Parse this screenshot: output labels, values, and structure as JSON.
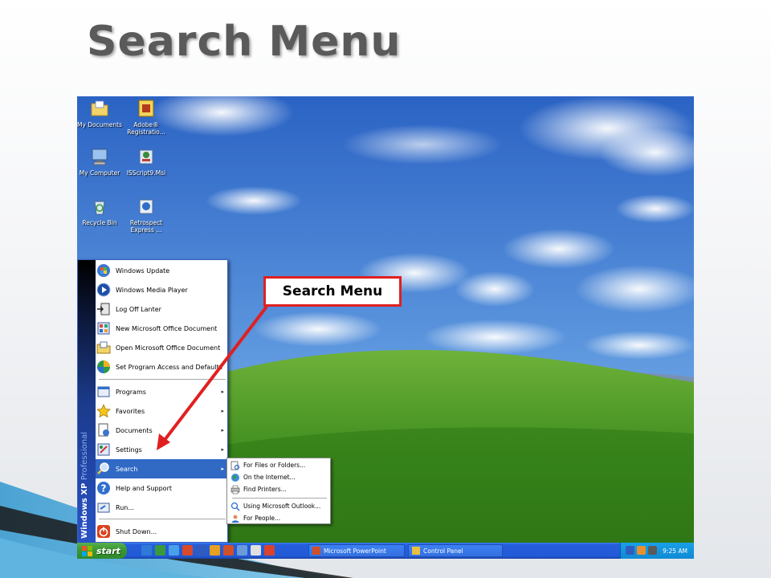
{
  "slide": {
    "title": "Search Menu"
  },
  "callout": {
    "label": "Search Menu",
    "color": "#e02020"
  },
  "desktop_icons": [
    {
      "label_line1": "My Documents",
      "label_line2": "",
      "icon": "folder-icon"
    },
    {
      "label_line1": "Adobe®",
      "label_line2": "Registratio...",
      "icon": "adobe-icon"
    },
    {
      "label_line1": "My Computer",
      "label_line2": "",
      "icon": "computer-icon"
    },
    {
      "label_line1": "ISScript9.Msi",
      "label_line2": "",
      "icon": "installer-icon"
    },
    {
      "label_line1": "Recycle Bin",
      "label_line2": "",
      "icon": "recycle-bin-icon"
    },
    {
      "label_line1": "Retrospect",
      "label_line2": "Express ...",
      "icon": "retrospect-icon"
    }
  ],
  "start_menu": {
    "banner": {
      "os": "Windows XP",
      "edition": "Professional"
    },
    "top_items": [
      {
        "label": "Windows Update",
        "icon": "windows-update-icon"
      },
      {
        "label": "Windows Media Player",
        "icon": "media-player-icon"
      },
      {
        "label": "Log Off Lanter",
        "icon": "log-off-icon"
      },
      {
        "label": "New Microsoft Office Document",
        "icon": "new-office-doc-icon"
      },
      {
        "label": "Open Microsoft Office Document",
        "icon": "open-office-doc-icon"
      },
      {
        "label": "Set Program Access and Defaults",
        "icon": "program-defaults-icon"
      }
    ],
    "main_items": [
      {
        "label": "Programs",
        "icon": "programs-icon",
        "arrow": "▸"
      },
      {
        "label": "Favorites",
        "icon": "favorites-icon",
        "arrow": "▸"
      },
      {
        "label": "Documents",
        "icon": "documents-icon",
        "arrow": "▸"
      },
      {
        "label": "Settings",
        "icon": "settings-icon",
        "arrow": "▸"
      },
      {
        "label": "Search",
        "icon": "search-icon",
        "arrow": "▸"
      },
      {
        "label": "Help and Support",
        "icon": "help-icon",
        "arrow": ""
      },
      {
        "label": "Run...",
        "icon": "run-icon",
        "arrow": ""
      }
    ],
    "shutdown": {
      "label": "Shut Down...",
      "icon": "shutdown-icon"
    },
    "highlight_color": "#316ac5"
  },
  "search_submenu": {
    "items": [
      {
        "label": "For Files or Folders...",
        "icon": "files-folders-icon"
      },
      {
        "label": "On the Internet...",
        "icon": "internet-icon"
      },
      {
        "label": "Find Printers...",
        "icon": "printer-icon"
      },
      {
        "label": "Using Microsoft Outlook...",
        "icon": "outlook-icon"
      },
      {
        "label": "For People...",
        "icon": "people-icon"
      }
    ]
  },
  "taskbar": {
    "start_label": "start",
    "tasks": [
      {
        "label": "Microsoft PowerPoint",
        "icon": "powerpoint-icon"
      },
      {
        "label": "Control Panel",
        "icon": "control-panel-icon"
      }
    ],
    "clock": "9:25 AM",
    "colors": {
      "bar": "#245edb",
      "start": "#3c9a34",
      "tray": "#0f8ad3"
    }
  }
}
